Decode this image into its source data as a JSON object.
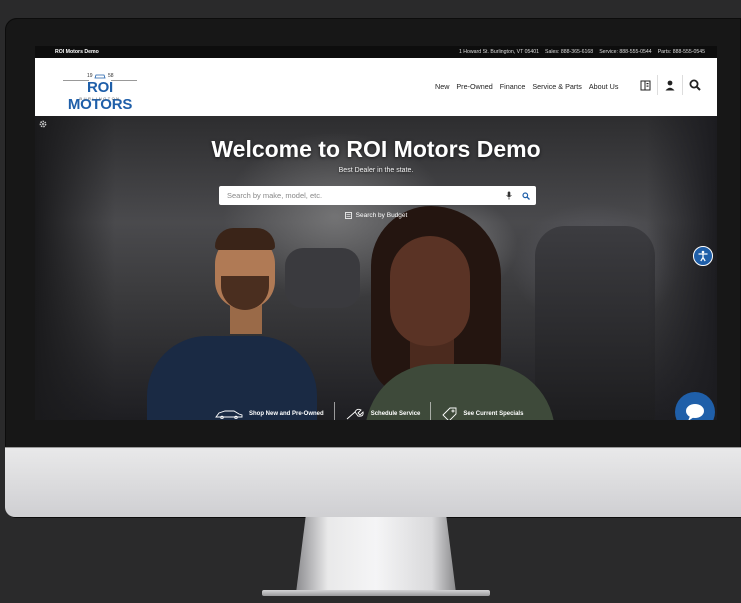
{
  "topbar": {
    "brand": "ROI Motors Demo",
    "address": "1 Howard St. Burlington, VT 05401",
    "sales": "Sales: 888-365-6168",
    "service": "Service: 888-555-0544",
    "parts": "Parts: 888-555-0545"
  },
  "logo": {
    "year_left": "19",
    "year_right": "58",
    "name": "ROI MOTORS",
    "city": "BURLINGTON"
  },
  "nav": {
    "items": [
      "New",
      "Pre-Owned",
      "Finance",
      "Service & Parts",
      "About Us"
    ]
  },
  "header_icons": [
    "saved-vehicles-icon",
    "account-icon",
    "search-icon"
  ],
  "hero": {
    "title": "Welcome to ROI Motors Demo",
    "subtitle": "Best Dealer in the state.",
    "search_placeholder": "Search by make, model, etc.",
    "budget_label": "Search by Budget"
  },
  "quick_links": [
    {
      "label": "Shop New and Pre-Owned",
      "icon": "car-icon"
    },
    {
      "label": "Schedule Service",
      "icon": "wrench-icon"
    },
    {
      "label": "See Current Specials",
      "icon": "tag-icon"
    }
  ],
  "colors": {
    "brand_blue": "#1f5fa9",
    "topbar_bg": "#0d0d0d"
  }
}
